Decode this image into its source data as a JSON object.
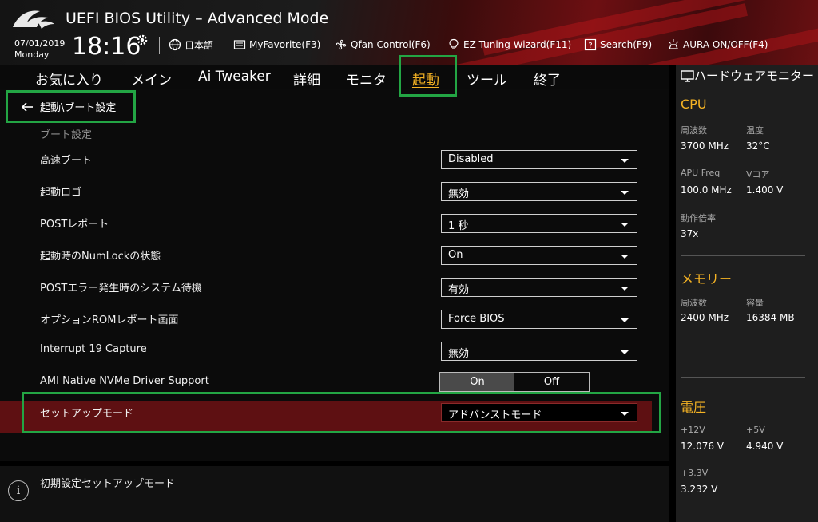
{
  "header": {
    "title": "UEFI BIOS Utility – Advanced Mode",
    "date": "07/01/2019",
    "day": "Monday",
    "time": "18:16",
    "language": "日本語",
    "myfavorite": "MyFavorite(F3)",
    "qfan": "Qfan Control(F6)",
    "ez_tuning": "EZ Tuning Wizard(F11)",
    "search": "Search(F9)",
    "aura": "AURA ON/OFF(F4)"
  },
  "tabs": [
    "お気に入り",
    "メイン",
    "Ai Tweaker",
    "詳細",
    "モニタ",
    "起動",
    "ツール",
    "終了"
  ],
  "active_tab": "起動",
  "breadcrumb": "起動\\ブート設定",
  "section_title": "ブート設定",
  "settings": [
    {
      "label": "高速ブート",
      "value": "Disabled"
    },
    {
      "label": "起動ロゴ",
      "value": "無効"
    },
    {
      "label": "POSTレポート",
      "value": "1 秒"
    },
    {
      "label": "起動時のNumLockの状態",
      "value": "On"
    },
    {
      "label": "POSTエラー発生時のシステム待機",
      "value": "有効"
    },
    {
      "label": "オプションROMレポート画面",
      "value": "Force BIOS"
    },
    {
      "label": "Interrupt 19 Capture",
      "value": "無効"
    }
  ],
  "nvme": {
    "label": "AMI Native NVMe Driver Support",
    "on": "On",
    "off": "Off",
    "selected": "On"
  },
  "setup_mode": {
    "label": "セットアップモード",
    "value": "アドバンストモード"
  },
  "help_text": "初期設定セットアップモード",
  "monitor": {
    "title": "ハードウェアモニター",
    "cpu": {
      "heading": "CPU",
      "freq_label": "周波数",
      "freq": "3700 MHz",
      "temp_label": "温度",
      "temp": "32°C",
      "apu_label": "APU Freq",
      "apu": "100.0 MHz",
      "vcore_label": "Vコア",
      "vcore": "1.400 V",
      "ratio_label": "動作倍率",
      "ratio": "37x"
    },
    "memory": {
      "heading": "メモリー",
      "freq_label": "周波数",
      "freq": "2400 MHz",
      "cap_label": "容量",
      "cap": "16384 MB"
    },
    "voltage": {
      "heading": "電圧",
      "v12_label": "+12V",
      "v12": "12.076 V",
      "v5_label": "+5V",
      "v5": "4.940 V",
      "v33_label": "+3.3V",
      "v33": "3.232 V"
    }
  },
  "colors": {
    "accent": "#f5b324",
    "highlight": "#23a544",
    "selected_row": "#5e1012"
  }
}
